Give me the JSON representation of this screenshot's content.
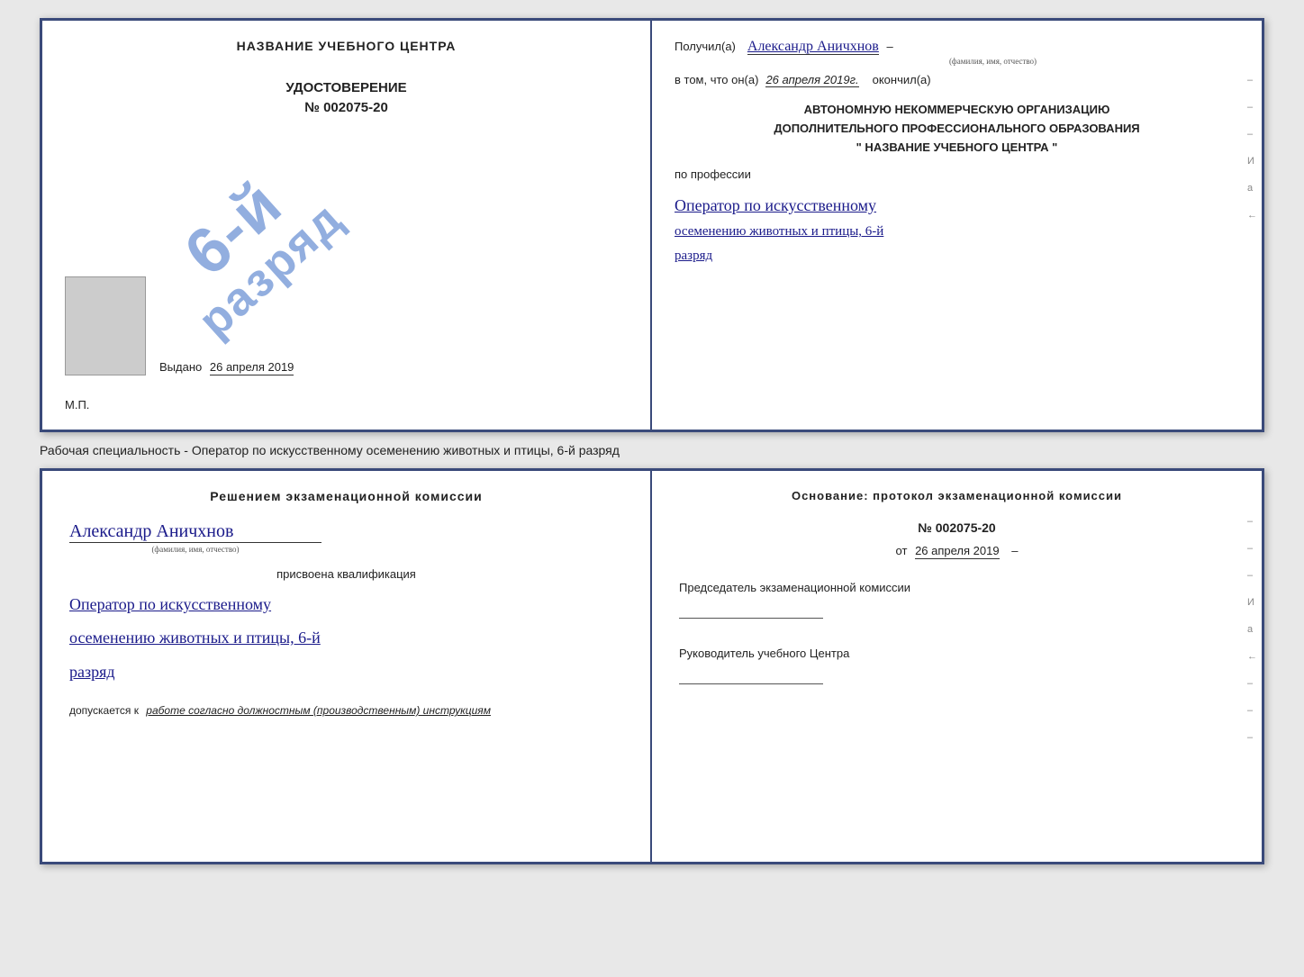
{
  "top_book": {
    "left": {
      "title": "НАЗВАНИЕ УЧЕБНОГО ЦЕНТРА",
      "cert_type": "УДОСТОВЕРЕНИЕ",
      "cert_number": "№ 002075-20",
      "issued_label": "Выдано",
      "issued_date": "26 апреля 2019",
      "mp_label": "М.П.",
      "stamp_line1": "6-й",
      "stamp_line2": "разряд"
    },
    "right": {
      "received_label": "Получил(а)",
      "received_name": "Александр Аничхнов",
      "name_subtitle": "(фамилия, имя, отчество)",
      "dash": "–",
      "in_that_label": "в том, что он(а)",
      "date_handwritten": "26 апреля 2019г.",
      "finished_label": "окончил(а)",
      "org_line1": "АВТОНОМНУЮ НЕКОММЕРЧЕСКУЮ ОРГАНИЗАЦИЮ",
      "org_line2": "ДОПОЛНИТЕЛЬНОГО ПРОФЕССИОНАЛЬНОГО ОБРАЗОВАНИЯ",
      "org_name": "\"  НАЗВАНИЕ УЧЕБНОГО ЦЕНТРА  \"",
      "profession_label": "по профессии",
      "profession_handwritten_1": "Оператор по искусственному",
      "profession_handwritten_2": "осеменению животных и птицы, 6-й",
      "profession_handwritten_3": "разряд",
      "side_marks": [
        "-",
        "-",
        "-",
        "И",
        "а",
        "←"
      ]
    }
  },
  "specialty_text": "Рабочая специальность - Оператор по искусственному осеменению животных и птицы, 6-й разряд",
  "bottom_book": {
    "left": {
      "heading": "Решением  экзаменационной  комиссии",
      "name": "Александр Аничхнов",
      "name_subtitle": "(фамилия, имя, отчество)",
      "assigned_label": "присвоена квалификация",
      "qual_line1": "Оператор по искусственному",
      "qual_line2": "осеменению животных и птицы, 6-й",
      "qual_line3": "разряд",
      "allowed_label": "допускается к",
      "allowed_text": "работе согласно должностным (производственным) инструкциям"
    },
    "right": {
      "basis_label": "Основание: протокол экзаменационной комиссии",
      "number": "№  002075-20",
      "date_prefix": "от",
      "date": "26 апреля 2019",
      "chairman_label": "Председатель экзаменационной комиссии",
      "director_label": "Руководитель учебного Центра",
      "side_marks": [
        "-",
        "-",
        "-",
        "И",
        "а",
        "←",
        "-",
        "-",
        "-"
      ]
    }
  }
}
